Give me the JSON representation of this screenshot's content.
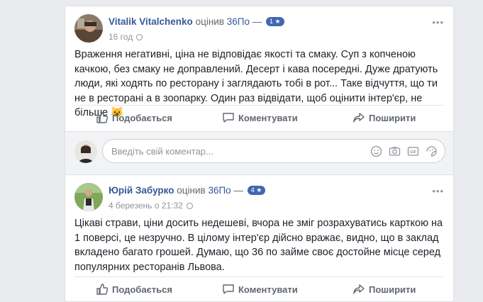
{
  "posts": [
    {
      "author": "Vitalik Vitalchenko",
      "rated_word": "оцінив",
      "place": "36По",
      "dash": "—",
      "rating": "1 ★",
      "time": "16 год",
      "text": "Враження негативні, ціна не відповідає якості та смаку. Суп з копченою качкою, без смаку не доправлений. Десерт і кава посередні. Дуже дратують люди, які ходять по ресторану і заглядають тобі в рот... Таке відчуття, що ти не в ресторані а в зоопарку. Один раз відвідати, щоб оцінити інтер'єр, не більше 😺",
      "more": "•••"
    },
    {
      "author": "Юрій Забурко",
      "rated_word": "оцінив",
      "place": "36По",
      "dash": "—",
      "rating": "4 ★",
      "time": "4 березень о 21:32",
      "text": "Цікаві страви, ціни досить недешеві, вчора не зміг розрахуватись карткою на 1 поверсі, це незручно. В цілому інтер'єр дійсно вражає, видно, що в заклад вкладено багато грошей. Думаю, що 36 по займе своє достойне місце серед популярних ресторанів Львова.",
      "more": "•••"
    }
  ],
  "actions": {
    "like": "Подобається",
    "comment": "Коментувати",
    "share": "Поширити"
  },
  "comment_box": {
    "placeholder": "Введіть свій коментар..."
  },
  "colors": {
    "link": "#365899",
    "badge": "#4267b2",
    "background": "#e9ebee"
  },
  "icons": [
    "like-icon",
    "comment-icon",
    "share-icon",
    "emoji-icon",
    "camera-icon",
    "gif-icon",
    "sticker-icon",
    "globe-icon"
  ]
}
